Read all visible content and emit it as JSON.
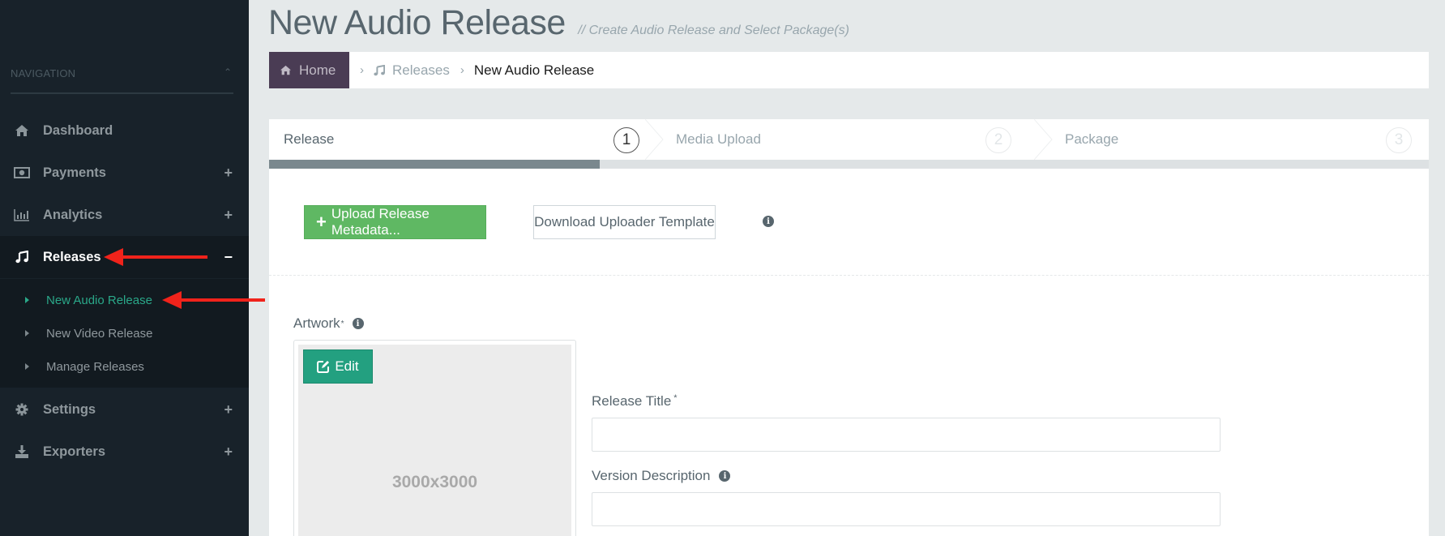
{
  "sidebar": {
    "nav_header": "NAVIGATION",
    "items": [
      {
        "label": "Dashboard",
        "icon": "home-icon",
        "toggle": ""
      },
      {
        "label": "Payments",
        "icon": "money-icon",
        "toggle": "+"
      },
      {
        "label": "Analytics",
        "icon": "bar-chart-icon",
        "toggle": "+"
      },
      {
        "label": "Releases",
        "icon": "music-icon",
        "toggle": "−"
      },
      {
        "label": "Settings",
        "icon": "gear-icon",
        "toggle": "+"
      },
      {
        "label": "Exporters",
        "icon": "download-icon",
        "toggle": "+"
      }
    ],
    "releases_submenu": [
      {
        "label": "New Audio Release",
        "active": true
      },
      {
        "label": "New Video Release",
        "active": false
      },
      {
        "label": "Manage Releases",
        "active": false
      }
    ]
  },
  "header": {
    "title": "New Audio Release",
    "subtitle": "// Create Audio Release and Select Package(s)"
  },
  "breadcrumb": {
    "home": "Home",
    "separator": "›",
    "releases": "Releases",
    "current": "New Audio Release"
  },
  "wizard": {
    "steps": [
      {
        "label": "Release",
        "number": "1",
        "active": true
      },
      {
        "label": "Media Upload",
        "number": "2",
        "active": false
      },
      {
        "label": "Package",
        "number": "3",
        "active": false
      }
    ],
    "progress_percent": 28.5
  },
  "actions": {
    "upload_label": "Upload Release Metadata...",
    "download_label": "Download Uploader Template",
    "info_glyph": "i"
  },
  "form": {
    "artwork_label": "Artwork",
    "artwork_required": "*",
    "edit_label": "Edit",
    "artwork_dimensions": "3000x3000",
    "release_title_label": "Release Title",
    "release_title_required": "*",
    "release_title_value": "",
    "version_description_label": "Version Description",
    "version_description_value": ""
  },
  "colors": {
    "sidebar_bg": "#18222a",
    "accent_green": "#5fb863",
    "accent_teal": "#23a080",
    "breadcrumb_home_bg": "#4a3c54",
    "annotation_red": "#f0231b"
  }
}
